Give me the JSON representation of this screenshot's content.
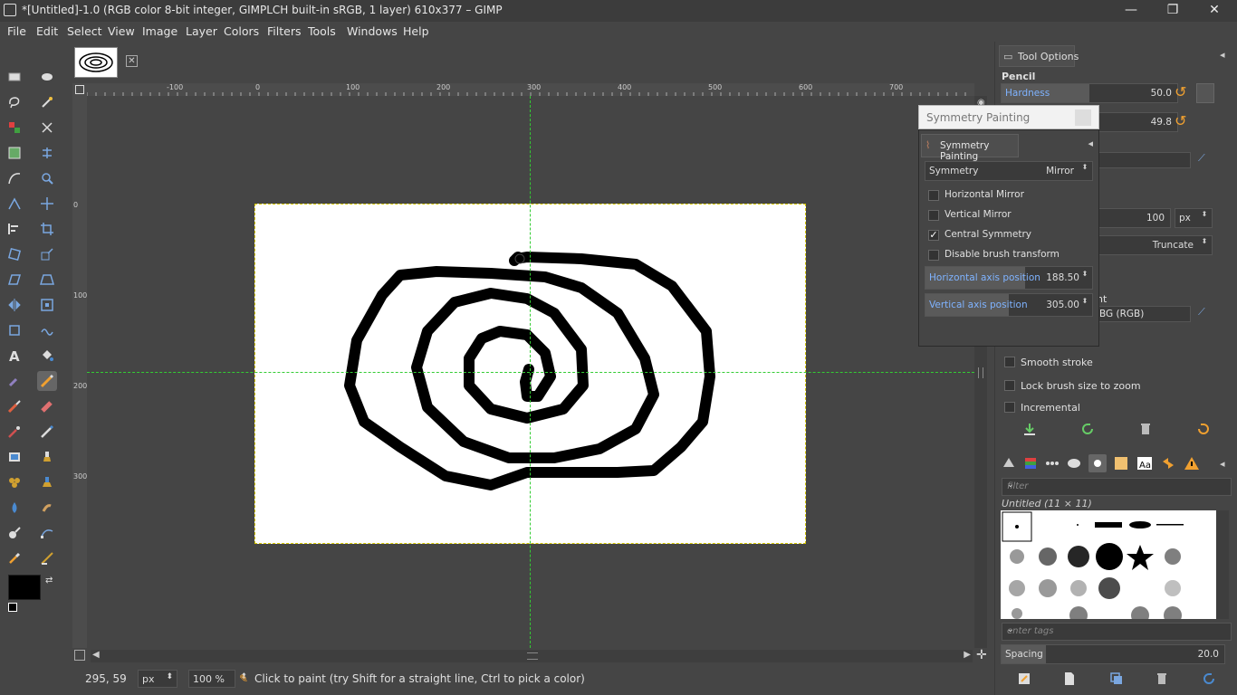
{
  "window": {
    "title": "*[Untitled]-1.0 (RGB color 8-bit integer, GIMPLCH built-in sRGB, 1 layer) 610x377 – GIMP",
    "minimize": "—",
    "maximize": "❐",
    "close": "✕"
  },
  "menu": [
    "File",
    "Edit",
    "Select",
    "View",
    "Image",
    "Layer",
    "Colors",
    "Filters",
    "Tools",
    "Windows",
    "Help"
  ],
  "rulers": {
    "h_labels": [
      "-100",
      "0",
      "100",
      "200",
      "300",
      "400",
      "500",
      "600",
      "700"
    ],
    "v_labels": [
      "0",
      "100",
      "200",
      "300"
    ]
  },
  "status": {
    "coords": "295, 59",
    "unit": "px",
    "zoom": "100 %",
    "message": "Click to paint (try Shift for a straight line, Ctrl to pick a color)"
  },
  "tool_options": {
    "tab_label": "Tool Options",
    "tool_name": "Pencil",
    "hardness_label": "Hardness",
    "hardness_value": "50.0",
    "hardness_fraction": 0.5,
    "second_value": "49.8",
    "size_value": "100",
    "size_unit": "px",
    "truncate": "Truncate",
    "gradient_label": "nt",
    "gradient_value": "BG (RGB)",
    "smooth_stroke": "Smooth stroke",
    "lock_brush": "Lock brush size to zoom",
    "incremental": "Incremental"
  },
  "symmetry": {
    "window_title": "Symmetry Painting",
    "tab_label": "Symmetry Painting",
    "symmetry_label": "Symmetry",
    "symmetry_value": "Mirror",
    "horizontal_mirror": "Horizontal Mirror",
    "vertical_mirror": "Vertical Mirror",
    "central_symmetry": "Central Symmetry",
    "disable_brush_transform": "Disable brush transform",
    "h_axis_label": "Horizontal axis position",
    "h_axis_value": "188.50",
    "v_axis_label": "Vertical axis position",
    "v_axis_value": "305.00",
    "central_checked": true
  },
  "brushes": {
    "filter_placeholder": "filter",
    "brush_name": "Untitled (11 × 11)",
    "tags_placeholder": "enter tags",
    "spacing_label": "Spacing",
    "spacing_value": "20.0"
  },
  "colors": {
    "guide": "#33cc33",
    "foreground": "#000000",
    "background": "#ffffff",
    "accent": "#7fb3ff"
  }
}
